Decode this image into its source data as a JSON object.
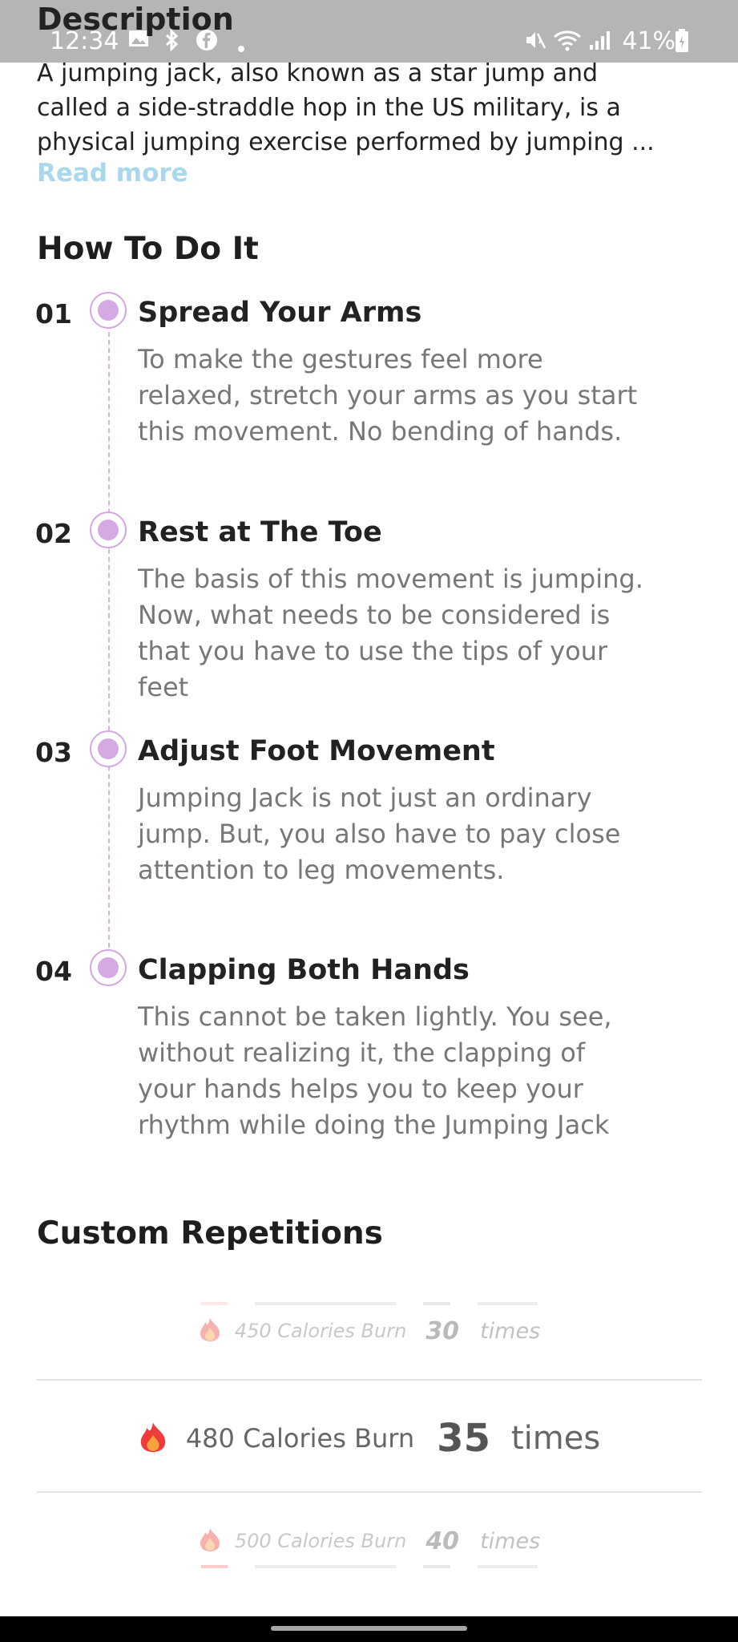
{
  "status_bar": {
    "time": "12:34",
    "battery": "41%",
    "left_icons": [
      "gallery-icon",
      "bluetooth-icon",
      "facebook-icon",
      "dot-icon"
    ],
    "right_icons": [
      "mute-icon",
      "wifi-icon",
      "signal-icon",
      "battery-icon"
    ]
  },
  "description": {
    "title": "Description",
    "line1": "A jumping jack, also known as a star jump and",
    "line2": "called a side-straddle hop in the US military, is a",
    "line3": "physical jumping exercise performed by jumping ...",
    "read_more": "Read more"
  },
  "how_to": {
    "title": "How To Do It",
    "steps": [
      {
        "number": "01",
        "title": "Spread Your Arms",
        "lines": [
          "To make the gestures feel more",
          "relaxed, stretch your arms as you start",
          "this movement. No bending of hands."
        ]
      },
      {
        "number": "02",
        "title": "Rest at The Toe",
        "lines": [
          "The basis of this movement is jumping.",
          "Now, what needs to be considered is",
          "that you have to use the tips of your",
          "feet"
        ]
      },
      {
        "number": "03",
        "title": "Adjust Foot Movement",
        "lines": [
          "Jumping Jack is not just an ordinary",
          "jump. But, you also have to pay close",
          "attention to leg movements."
        ]
      },
      {
        "number": "04",
        "title": "Clapping Both Hands",
        "lines": [
          "This cannot be taken lightly. You see,",
          "without realizing it, the clapping of",
          "your hands helps you to keep your",
          "rhythm while doing the Jumping Jack"
        ]
      }
    ]
  },
  "custom_repetitions": {
    "title": "Custom Repetitions",
    "options": [
      {
        "calories": "450 Calories Burn",
        "count": "30",
        "unit": "times"
      },
      {
        "calories": "480 Calories Burn",
        "count": "35",
        "unit": "times"
      },
      {
        "calories": "500 Calories Burn",
        "count": "40",
        "unit": "times"
      }
    ],
    "selected_index": 1
  },
  "colors": {
    "accent": "#d5a9e2",
    "link": "#a9d8ec",
    "flame_red": "#ef3b3b",
    "flame_orange": "#f7a23a"
  }
}
